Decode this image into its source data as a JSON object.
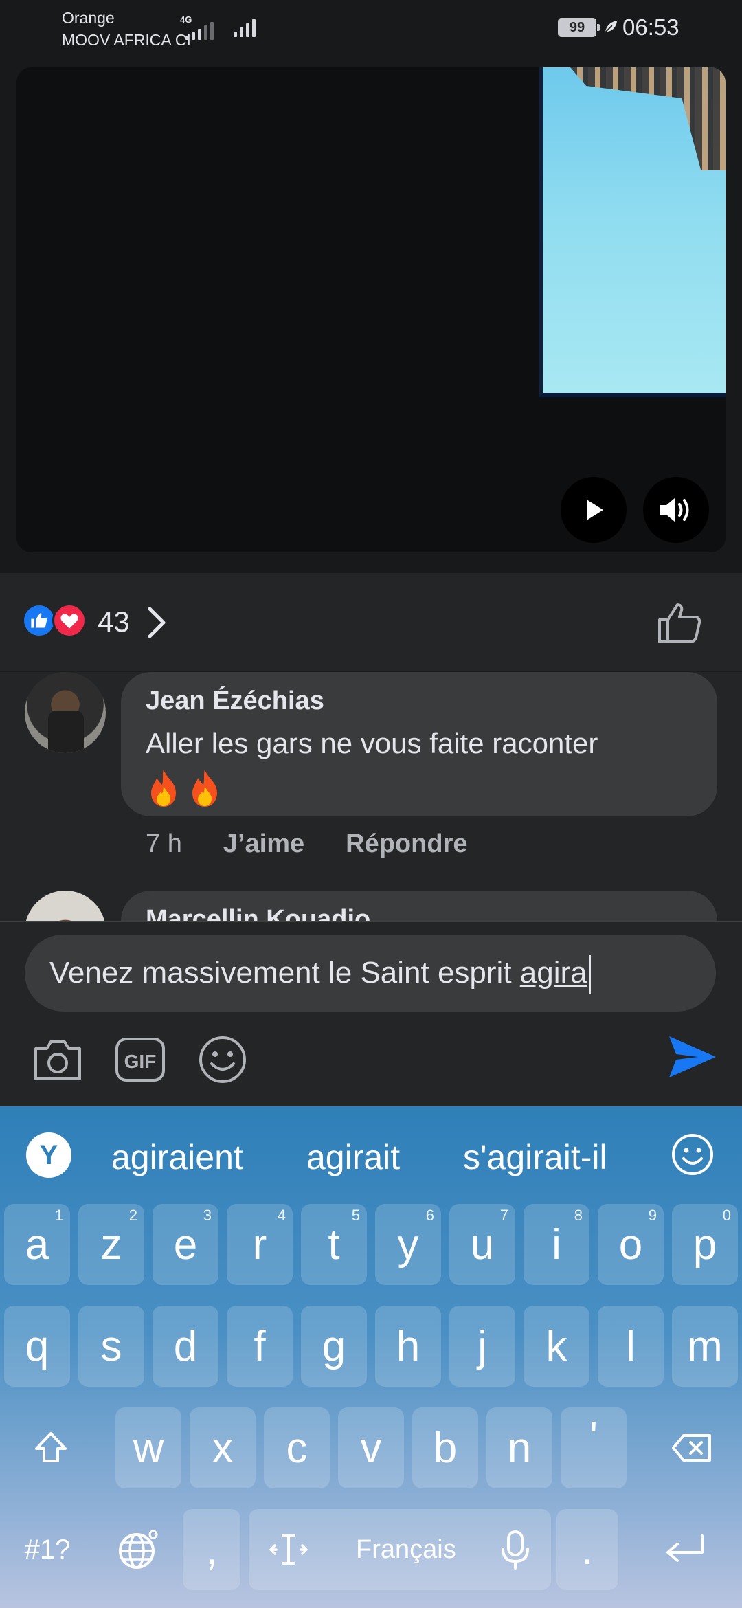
{
  "status_bar": {
    "carrier_1": "Orange",
    "carrier_2": "MOOV AFRICA CI",
    "network_type": "4G",
    "battery": "99",
    "time": "06:53"
  },
  "reactions": {
    "count": "43",
    "icons": [
      "like-icon",
      "love-icon"
    ]
  },
  "comments": [
    {
      "name": "Jean Ézéchias",
      "text": "Aller les gars ne vous faite raconter",
      "emoji": "🔥🔥",
      "time": "7 h",
      "like_label": "J’aime",
      "reply_label": "Répondre"
    },
    {
      "name": "Marcellin Kouadio"
    }
  ],
  "composer": {
    "text_before": "Venez massivement le Saint esprit ",
    "text_current_word": "agira",
    "tools": [
      "camera-icon",
      "gif-icon",
      "emoji-icon"
    ]
  },
  "keyboard": {
    "suggestions": [
      "agiraient",
      "agirait",
      "s'agirait-il"
    ],
    "row1": [
      "a",
      "z",
      "e",
      "r",
      "t",
      "y",
      "u",
      "i",
      "o",
      "p"
    ],
    "row1_hints": [
      "1",
      "2",
      "3",
      "4",
      "5",
      "6",
      "7",
      "8",
      "9",
      "0"
    ],
    "row2": [
      "q",
      "s",
      "d",
      "f",
      "g",
      "h",
      "j",
      "k",
      "l",
      "m"
    ],
    "row3": [
      "w",
      "x",
      "c",
      "v",
      "b",
      "n",
      "'"
    ],
    "symbols_key": "#1?",
    "comma_key": ",",
    "space_label": "Français",
    "period_key": "."
  },
  "colors": {
    "accent": "#1877f2",
    "love": "#f02849",
    "background": "#242526",
    "bubble": "#3a3b3c",
    "keyboard_top": "#2f7fb8"
  }
}
